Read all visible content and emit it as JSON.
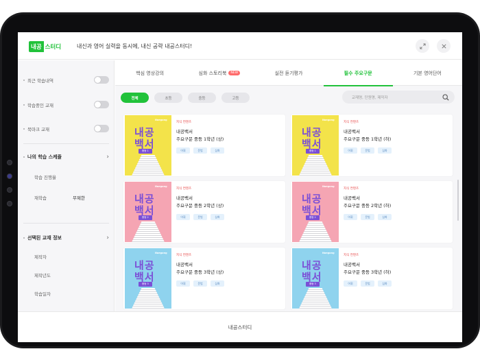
{
  "header": {
    "logo_part1": "내공",
    "logo_part2": "스터디",
    "slogan": "내신과 영어 실력을 동시에, 내신 공략 내공스터디!",
    "expand_icon": "expand-icon",
    "close_icon": "close-icon"
  },
  "sidebar": {
    "toggles": [
      {
        "label": "최근 학습내역",
        "on": false
      },
      {
        "label": "학습중인 교재",
        "on": false
      },
      {
        "label": "북마크 교재",
        "on": false
      }
    ],
    "schedule": {
      "title": "나의 학습 스케줄",
      "items": [
        {
          "label": "학습 진행율",
          "value": ""
        },
        {
          "label": "재학습",
          "value": "무제한"
        }
      ]
    },
    "book_info": {
      "title": "선택된 교재 정보",
      "items": [
        "제작자",
        "제작년도",
        "학습일자"
      ]
    }
  },
  "tabs": [
    {
      "label": "핵심 영상강의",
      "active": false,
      "badge": ""
    },
    {
      "label": "심화 스토리북",
      "active": false,
      "badge": "NEW"
    },
    {
      "label": "실전 듣기평가",
      "active": false,
      "badge": ""
    },
    {
      "label": "필수 주요구문",
      "active": true,
      "badge": ""
    },
    {
      "label": "기본 영어단어",
      "active": false,
      "badge": ""
    }
  ],
  "filters": [
    "전체",
    "초등",
    "중등",
    "고등"
  ],
  "search": {
    "placeholder": "교재명, 단원명, 제작자"
  },
  "books": [
    {
      "category": "지식 컨텐츠",
      "title1": "내공백서",
      "title2": "주요구문 중등 1학년 (상)",
      "cover_title1": "내공",
      "cover_title2": "백서",
      "cover_grade": "중등 1",
      "cover_brand": "Naegong",
      "color": "#f3e34a",
      "tags": [
        "어휘",
        "문법",
        "심화"
      ]
    },
    {
      "category": "지식 컨텐츠",
      "title1": "내공백서",
      "title2": "주요구문 중등 1학년 (하)",
      "cover_title1": "내공",
      "cover_title2": "백서",
      "cover_grade": "중등 1",
      "cover_brand": "Naegong",
      "color": "#f3e34a",
      "tags": [
        "어휘",
        "문법",
        "심화"
      ]
    },
    {
      "category": "지식 컨텐츠",
      "title1": "내공백서",
      "title2": "주요구문 중등 2학년 (상)",
      "cover_title1": "내공",
      "cover_title2": "백서",
      "cover_grade": "중등 2",
      "cover_brand": "Naegong",
      "color": "#f5a5b3",
      "tags": [
        "어휘",
        "문법",
        "심화"
      ]
    },
    {
      "category": "지식 컨텐츠",
      "title1": "내공백서",
      "title2": "주요구문 중등 2학년 (하)",
      "cover_title1": "내공",
      "cover_title2": "백서",
      "cover_grade": "중등 2",
      "cover_brand": "Naegong",
      "color": "#f5a5b3",
      "tags": [
        "어휘",
        "문법",
        "심화"
      ]
    },
    {
      "category": "지식 컨텐츠",
      "title1": "내공백서",
      "title2": "주요구문 중등 3학년 (상)",
      "cover_title1": "내공",
      "cover_title2": "백서",
      "cover_grade": "중등 3",
      "cover_brand": "Naegong",
      "color": "#8fd3ee",
      "tags": [
        "어휘",
        "문법",
        "심화"
      ]
    },
    {
      "category": "지식 컨텐츠",
      "title1": "내공백서",
      "title2": "주요구문 중등 3학년 (하)",
      "cover_title1": "내공",
      "cover_title2": "백서",
      "cover_grade": "중등 3",
      "cover_brand": "Naegong",
      "color": "#8fd3ee",
      "tags": [
        "어휘",
        "문법",
        "심화"
      ]
    }
  ],
  "footer": {
    "label": "내공스터디"
  },
  "colors": {
    "accent": "#21c23a",
    "new_badge": "#ff6b6b"
  }
}
